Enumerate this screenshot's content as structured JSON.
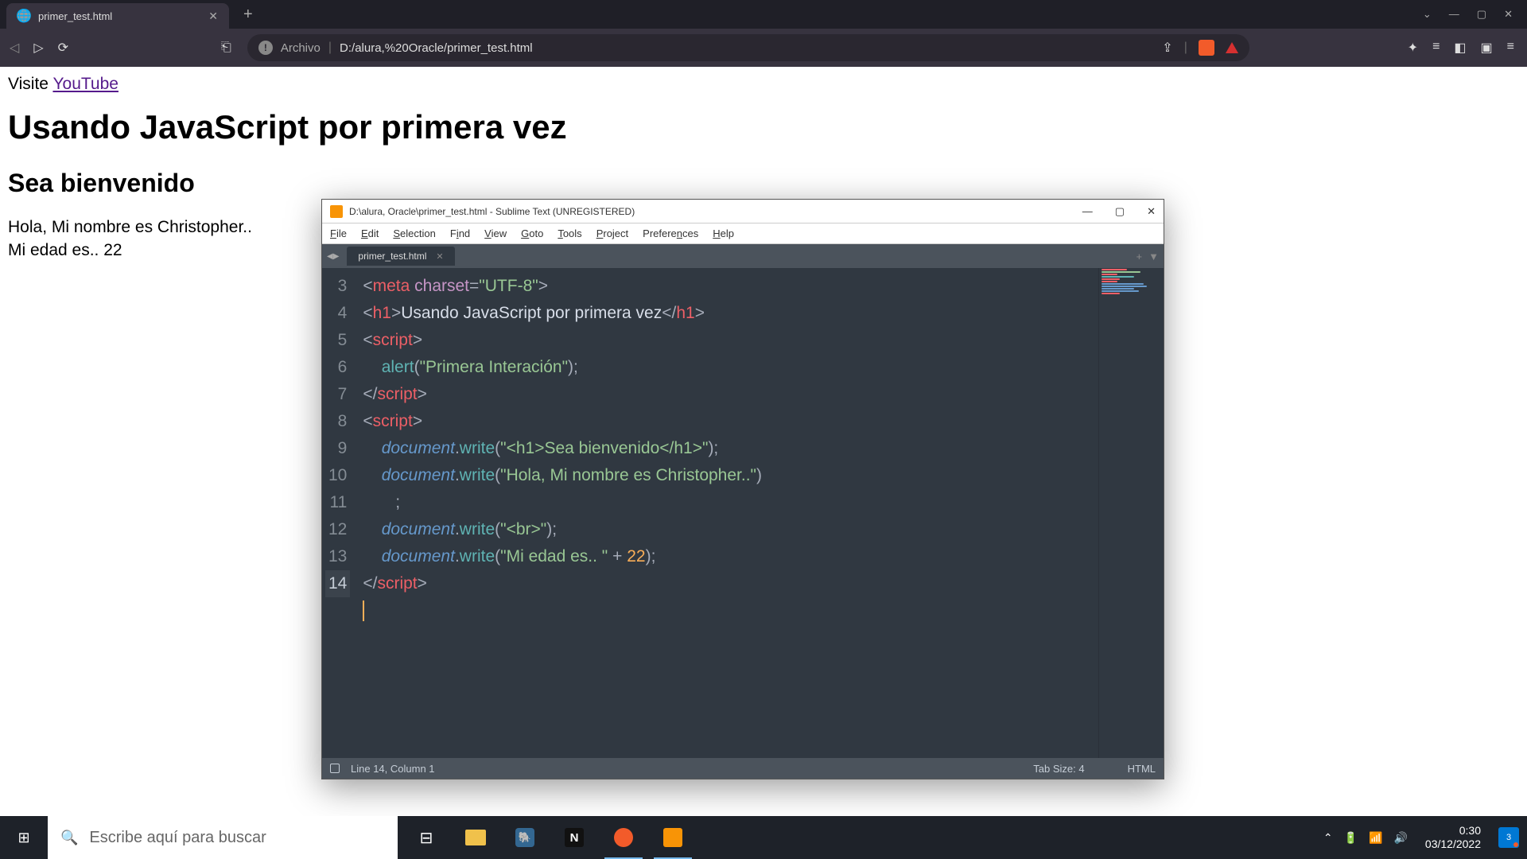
{
  "browser": {
    "tab_title": "primer_test.html",
    "address_label": "Archivo",
    "address_url": "D:/alura,%20Oracle/primer_test.html"
  },
  "page": {
    "visite": "Visite ",
    "youtube": "YouTube",
    "h1": "Usando JavaScript por primera vez",
    "h2": "Sea bienvenido",
    "line1": "Hola, Mi nombre es Christopher..",
    "line2": "Mi edad es.. 22"
  },
  "sublime": {
    "title": "D:\\alura, Oracle\\primer_test.html - Sublime Text (UNREGISTERED)",
    "menu": [
      "File",
      "Edit",
      "Selection",
      "Find",
      "View",
      "Goto",
      "Tools",
      "Project",
      "Preferences",
      "Help"
    ],
    "tab": "primer_test.html",
    "status_left": "Line 14, Column 1",
    "status_tab": "Tab Size: 4",
    "status_lang": "HTML",
    "lines": [
      3,
      4,
      5,
      6,
      7,
      8,
      9,
      10,
      11,
      12,
      13,
      14
    ],
    "code": {
      "l3_meta": "meta",
      "l3_charset": "charset",
      "l3_utf": "\"UTF-8\"",
      "l4_h1": "h1",
      "l4_text": "Usando JavaScript por primera vez",
      "l5_script": "script",
      "l6_alert": "alert",
      "l6_str": "\"Primera Interación\"",
      "l7_script": "script",
      "l8_script": "script",
      "l9_doc": "document",
      "l9_write": "write",
      "l9_str": "\"<h1>Sea bienvenido</h1>\"",
      "l10_doc": "document",
      "l10_write": "write",
      "l10_str": "\"Hola, Mi nombre es Christopher..\"",
      "l11_doc": "document",
      "l11_write": "write",
      "l11_str": "\"<br>\"",
      "l12_doc": "document",
      "l12_write": "write",
      "l12_str": "\"Mi edad es.. \"",
      "l12_num": "22",
      "l13_script": "script"
    }
  },
  "taskbar": {
    "search_placeholder": "Escribe aquí para buscar",
    "time": "0:30",
    "date": "03/12/2022",
    "noti_count": "3"
  }
}
